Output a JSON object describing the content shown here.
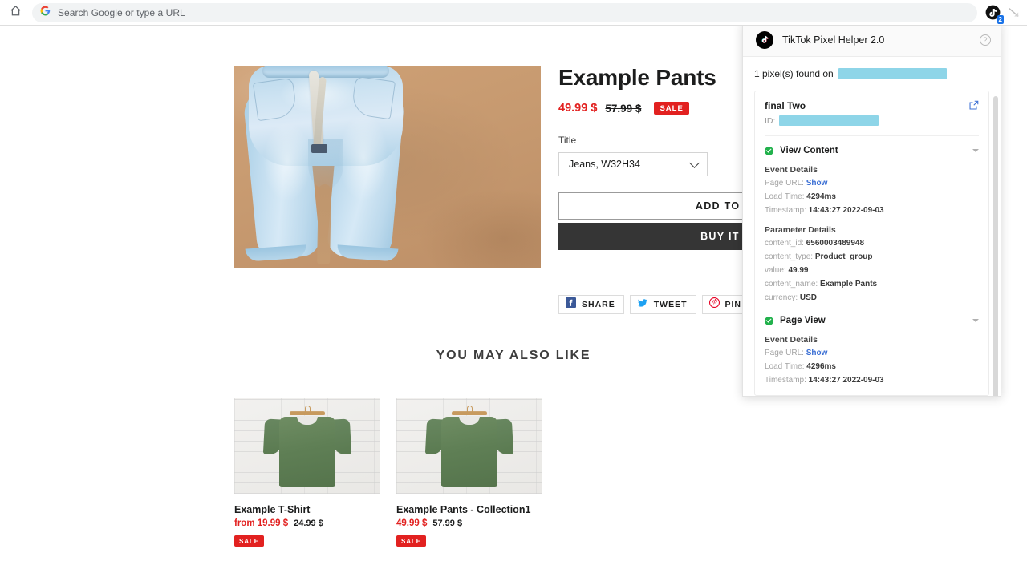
{
  "browser": {
    "home_icon": "home-icon",
    "search_icon": "google-g-icon",
    "omnibox_placeholder": "Search Google or type a URL",
    "extension_icon": "tiktok-pixel-helper-icon",
    "extension_badge": "2",
    "second_extension_icon": "extension-icon"
  },
  "product": {
    "title": "Example Pants",
    "price": "49.99 $",
    "compare_at_price": "57.99 $",
    "sale_badge": "SALE",
    "variant_label": "Title",
    "variant_value": "Jeans, W32H34",
    "variant_options": [
      "Jeans, W32H34"
    ],
    "add_to_cart_label": "ADD TO CART",
    "buy_now_label": "BUY IT NOW",
    "image_alt": "light-blue-jeans-on-tan-background"
  },
  "share": {
    "buttons": [
      {
        "label": "SHARE",
        "icon": "facebook-icon",
        "color": "#3b5998"
      },
      {
        "label": "TWEET",
        "icon": "twitter-icon",
        "color": "#1da1f2"
      },
      {
        "label": "PIN IT",
        "icon": "pinterest-icon",
        "color": "#e60023"
      }
    ]
  },
  "recommendations": {
    "heading": "YOU MAY ALSO LIKE",
    "items": [
      {
        "title": "Example T-Shirt",
        "price": "from 19.99 $",
        "compare_at_price": "24.99 $",
        "sale_badge": "SALE",
        "image_alt": "green-tshirt-on-hanger"
      },
      {
        "title": "Example Pants - Collection1",
        "price": "49.99 $",
        "compare_at_price": "57.99 $",
        "sale_badge": "SALE",
        "image_alt": "green-tshirt-on-hanger"
      }
    ]
  },
  "pixel_helper": {
    "title": "TikTok Pixel Helper 2.0",
    "logo_icon": "tiktok-logo-icon",
    "help_icon": "help-circle-icon",
    "found_text": "1 pixel(s) found on",
    "found_redacted": true,
    "pixel": {
      "name": "final Two",
      "id_label": "ID:",
      "id_redacted": true,
      "open_icon": "external-link-icon"
    },
    "events": [
      {
        "name": "View Content",
        "status_icon": "check-circle-icon",
        "caret_icon": "caret-down-icon",
        "event_details_title": "Event Details",
        "event_details": [
          {
            "key": "Page URL:",
            "value": "Show",
            "is_link": true
          },
          {
            "key": "Load Time:",
            "value": "4294ms",
            "is_link": false
          },
          {
            "key": "Timestamp:",
            "value": "14:43:27 2022-09-03",
            "is_link": false
          }
        ],
        "parameter_details_title": "Parameter Details",
        "parameter_details": [
          {
            "key": "content_id:",
            "value": "6560003489948"
          },
          {
            "key": "content_type:",
            "value": "Product_group"
          },
          {
            "key": "value:",
            "value": "49.99"
          },
          {
            "key": "content_name:",
            "value": "Example Pants"
          },
          {
            "key": "currency:",
            "value": "USD"
          }
        ]
      },
      {
        "name": "Page View",
        "status_icon": "check-circle-icon",
        "caret_icon": "caret-down-icon",
        "event_details_title": "Event Details",
        "event_details": [
          {
            "key": "Page URL:",
            "value": "Show",
            "is_link": true
          },
          {
            "key": "Load Time:",
            "value": "4296ms",
            "is_link": false
          },
          {
            "key": "Timestamp:",
            "value": "14:43:27 2022-09-03",
            "is_link": false
          }
        ],
        "parameter_details_title": "",
        "parameter_details": []
      }
    ]
  },
  "colors": {
    "sale_red": "#e22120",
    "buy_now_dark": "#353535",
    "redaction_blue": "#8ed5e8",
    "success_green": "#22b14c",
    "link_blue": "#3b6fd4"
  }
}
